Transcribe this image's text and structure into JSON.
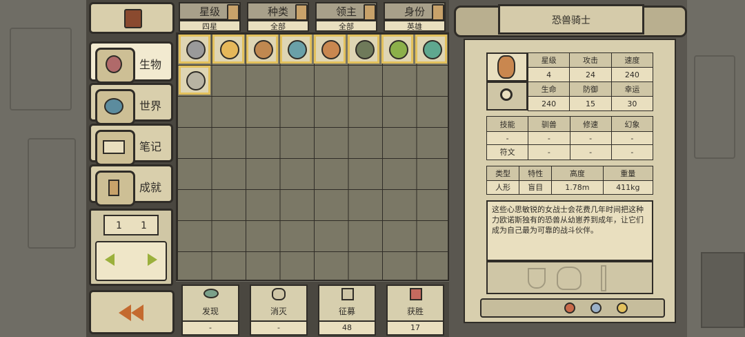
{
  "left_menu": {
    "tabs": [
      {
        "label": "生物",
        "icon": "creature-icon"
      },
      {
        "label": "世界",
        "icon": "world-icon"
      },
      {
        "label": "笔记",
        "icon": "notes-icon"
      },
      {
        "label": "成就",
        "icon": "achievement-icon"
      }
    ],
    "page_left": "1",
    "page_right": "1"
  },
  "filters": [
    {
      "label": "星级",
      "value": "四星"
    },
    {
      "label": "种类",
      "value": "全部"
    },
    {
      "label": "领主",
      "value": "全部"
    },
    {
      "label": "身份",
      "value": "英雄"
    }
  ],
  "bottom_stats": [
    {
      "label": "发现",
      "value": "-"
    },
    {
      "label": "消灭",
      "value": "-"
    },
    {
      "label": "征募",
      "value": "48"
    },
    {
      "label": "获胜",
      "value": "17"
    }
  ],
  "detail": {
    "title": "恐兽骑士",
    "stat_headers_1": [
      "星级",
      "攻击",
      "速度"
    ],
    "stat_values_1": [
      "4",
      "24",
      "240"
    ],
    "stat_headers_2": [
      "生命",
      "防御",
      "幸运"
    ],
    "stat_values_2": [
      "240",
      "15",
      "30"
    ],
    "skills_header": [
      "技能",
      "驯兽",
      "修速",
      "幻象"
    ],
    "skills_row1": [
      "-",
      "-",
      "-",
      "-"
    ],
    "skills_row2": [
      "符文",
      "-",
      "-",
      "-"
    ],
    "type_header": [
      "类型",
      "特性",
      "高度",
      "重量"
    ],
    "type_values": [
      "人形",
      "盲目",
      "1.78m",
      "411kg"
    ],
    "description": "这些心思敏锐的女战士会花费几年时间把这种力欧诺斯独有的恐兽从幼崽养到成年，让它们成为自己最为可靠的战斗伙伴。"
  },
  "colors": {
    "highlight": "#e3c15d",
    "paper": "#d8cfae",
    "ink": "#2f2c27"
  }
}
